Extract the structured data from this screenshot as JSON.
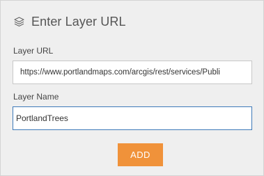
{
  "header": {
    "icon": "layers-icon",
    "title": "Enter Layer URL"
  },
  "form": {
    "url_label": "Layer URL",
    "url_value": "https://www.portlandmaps.com/arcgis/rest/services/Publi",
    "name_label": "Layer Name",
    "name_value": "PortlandTrees"
  },
  "actions": {
    "add_label": "ADD"
  },
  "colors": {
    "panel_bg": "#efefef",
    "accent": "#f0923a",
    "focus_border": "#3d79b8"
  }
}
